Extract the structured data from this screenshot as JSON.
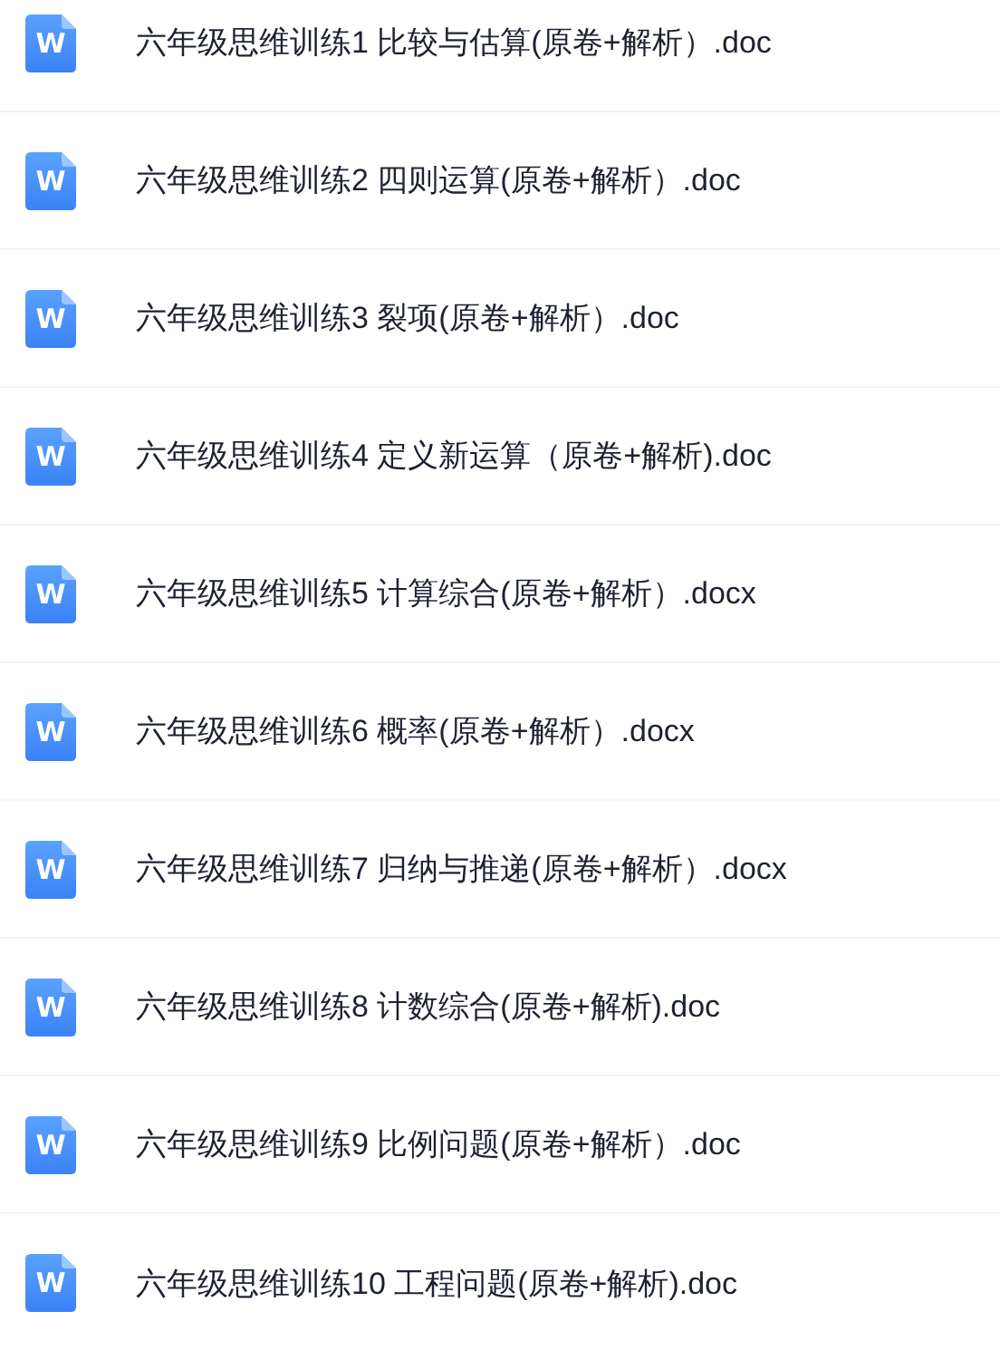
{
  "files": [
    {
      "name": "六年级思维训练1 比较与估算(原卷+解析）.doc",
      "icon_text": "W"
    },
    {
      "name": "六年级思维训练2 四则运算(原卷+解析）.doc",
      "icon_text": "W"
    },
    {
      "name": "六年级思维训练3 裂项(原卷+解析）.doc",
      "icon_text": "W"
    },
    {
      "name": "六年级思维训练4 定义新运算（原卷+解析).doc",
      "icon_text": "W"
    },
    {
      "name": "六年级思维训练5 计算综合(原卷+解析）.docx",
      "icon_text": "W"
    },
    {
      "name": "六年级思维训练6 概率(原卷+解析）.docx",
      "icon_text": "W"
    },
    {
      "name": "六年级思维训练7 归纳与推递(原卷+解析）.docx",
      "icon_text": "W"
    },
    {
      "name": "六年级思维训练8 计数综合(原卷+解析).doc",
      "icon_text": "W"
    },
    {
      "name": "六年级思维训练9 比例问题(原卷+解析）.doc",
      "icon_text": "W"
    },
    {
      "name": "六年级思维训练10 工程问题(原卷+解析).doc",
      "icon_text": "W"
    }
  ]
}
